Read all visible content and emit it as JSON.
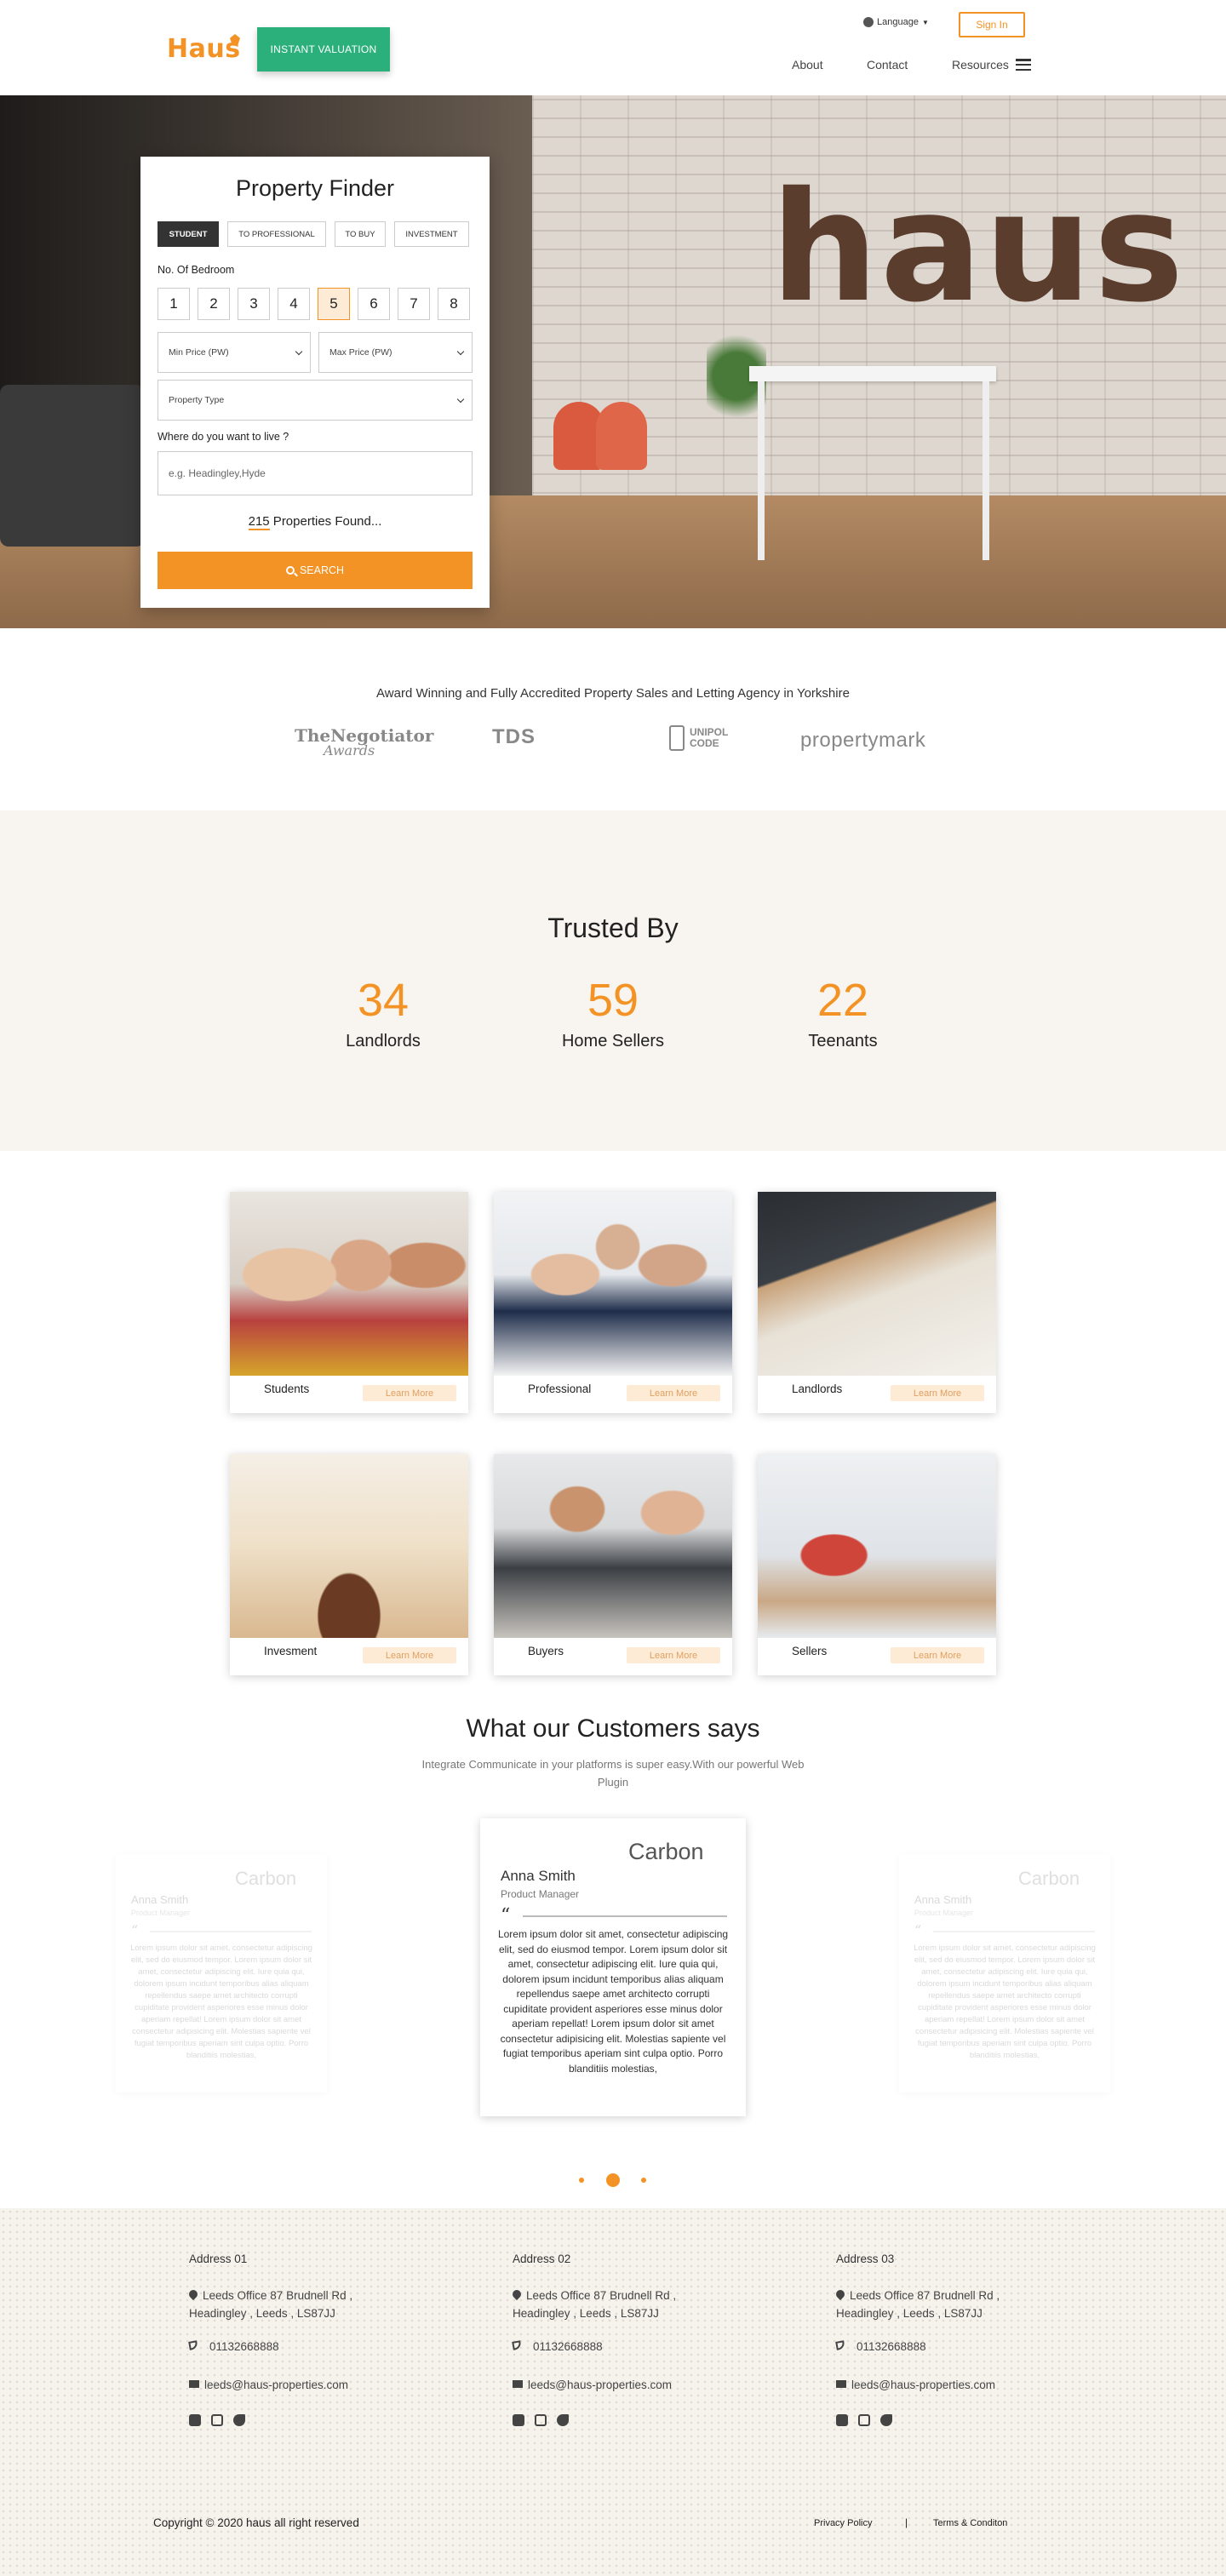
{
  "header": {
    "logo": "Haus",
    "valuation_label": "INSTANT VALUATION",
    "language_label": "Language",
    "signin_label": "Sign In",
    "nav": {
      "about": "About",
      "contact": "Contact",
      "resources": "Resources"
    }
  },
  "hero": {
    "wall_text": "haus"
  },
  "finder": {
    "title": "Property Finder",
    "tabs": [
      "STUDENT",
      "TO PROFESSIONAL",
      "TO BUY",
      "INVESTMENT"
    ],
    "active_tab": "STUDENT",
    "bedroom_label": "No. Of Bedroom",
    "bedrooms": [
      "1",
      "2",
      "3",
      "4",
      "5",
      "6",
      "7",
      "8"
    ],
    "selected_bedroom": "5",
    "min_price": "Min Price (PW)",
    "max_price": "Max Price (PW)",
    "property_type": "Property Type",
    "live_label": "Where do you want to live ?",
    "live_placeholder": "e.g. Headingley,Hyde",
    "found_count": "215",
    "found_text": " Properties Found...",
    "search_label": "SEARCH"
  },
  "awards": {
    "text": "Award Winning and Fully Accredited Property Sales and Letting Agency in Yorkshire",
    "logos": {
      "negotiator": "TheNegotiator",
      "negotiator_sub": "Awards",
      "tds": "TDS",
      "unipol": "UNIPOL CODE",
      "propertymark": "propertymark"
    }
  },
  "trusted": {
    "title": "Trusted By",
    "stats": [
      {
        "value": "34",
        "label": "Landlords"
      },
      {
        "value": "59",
        "label": "Home Sellers"
      },
      {
        "value": "22",
        "label": "Teenants"
      }
    ]
  },
  "cards": [
    {
      "name": "Students",
      "button": "Learn More"
    },
    {
      "name": "Professional",
      "button": "Learn More"
    },
    {
      "name": "Landlords",
      "button": "Learn More"
    },
    {
      "name": "Invesment",
      "button": "Learn More"
    },
    {
      "name": "Buyers",
      "button": "Learn More"
    },
    {
      "name": "Sellers",
      "button": "Learn More"
    }
  ],
  "testimonials": {
    "title": "What our Customers says",
    "subtitle": "Integrate Communicate in your platforms is super easy.With our powerful Web Plugin",
    "items": [
      {
        "company": "Carbon",
        "name": "Anna Smith",
        "role": "Product Manager",
        "quote_mark": "“",
        "body": "Lorem ipsum dolor sit amet, consectetur adipiscing elit, sed do eiusmod tempor. Lorem ipsum dolor sit amet, consectetur adipiscing elit. Iure quia qui, dolorem ipsum incidunt temporibus alias aliquam repellendus saepe amet architecto corrupti cupiditate provident asperiores esse minus dolor aperiam repellat! Lorem ipsum dolor sit amet consectetur adipisicing elit. Molestias sapiente vel fugiat temporibus aperiam sint culpa optio. Porro blanditiis molestias,"
      }
    ]
  },
  "footer": {
    "columns": [
      {
        "title": "Address 01",
        "address": "Leeds Office 87 Brudnell Rd , Headingley , Leeds , LS87JJ",
        "phone": "01132668888",
        "email": "leeds@haus-properties.com"
      },
      {
        "title": "Address 02",
        "address": "Leeds Office 87 Brudnell Rd , Headingley , Leeds , LS87JJ",
        "phone": "01132668888",
        "email": "leeds@haus-properties.com"
      },
      {
        "title": "Address 03",
        "address": "Leeds Office 87 Brudnell Rd , Headingley , Leeds , LS87JJ",
        "phone": "01132668888",
        "email": "leeds@haus-properties.com"
      }
    ],
    "copyright": "Copyright © 2020 haus all right reserved",
    "privacy": "Privacy Policy",
    "separator": "|",
    "terms": "Terms & Conditon"
  },
  "colors": {
    "accent": "#f39325",
    "valuation": "#2bb07b",
    "light_bg": "#f8f5f0"
  }
}
